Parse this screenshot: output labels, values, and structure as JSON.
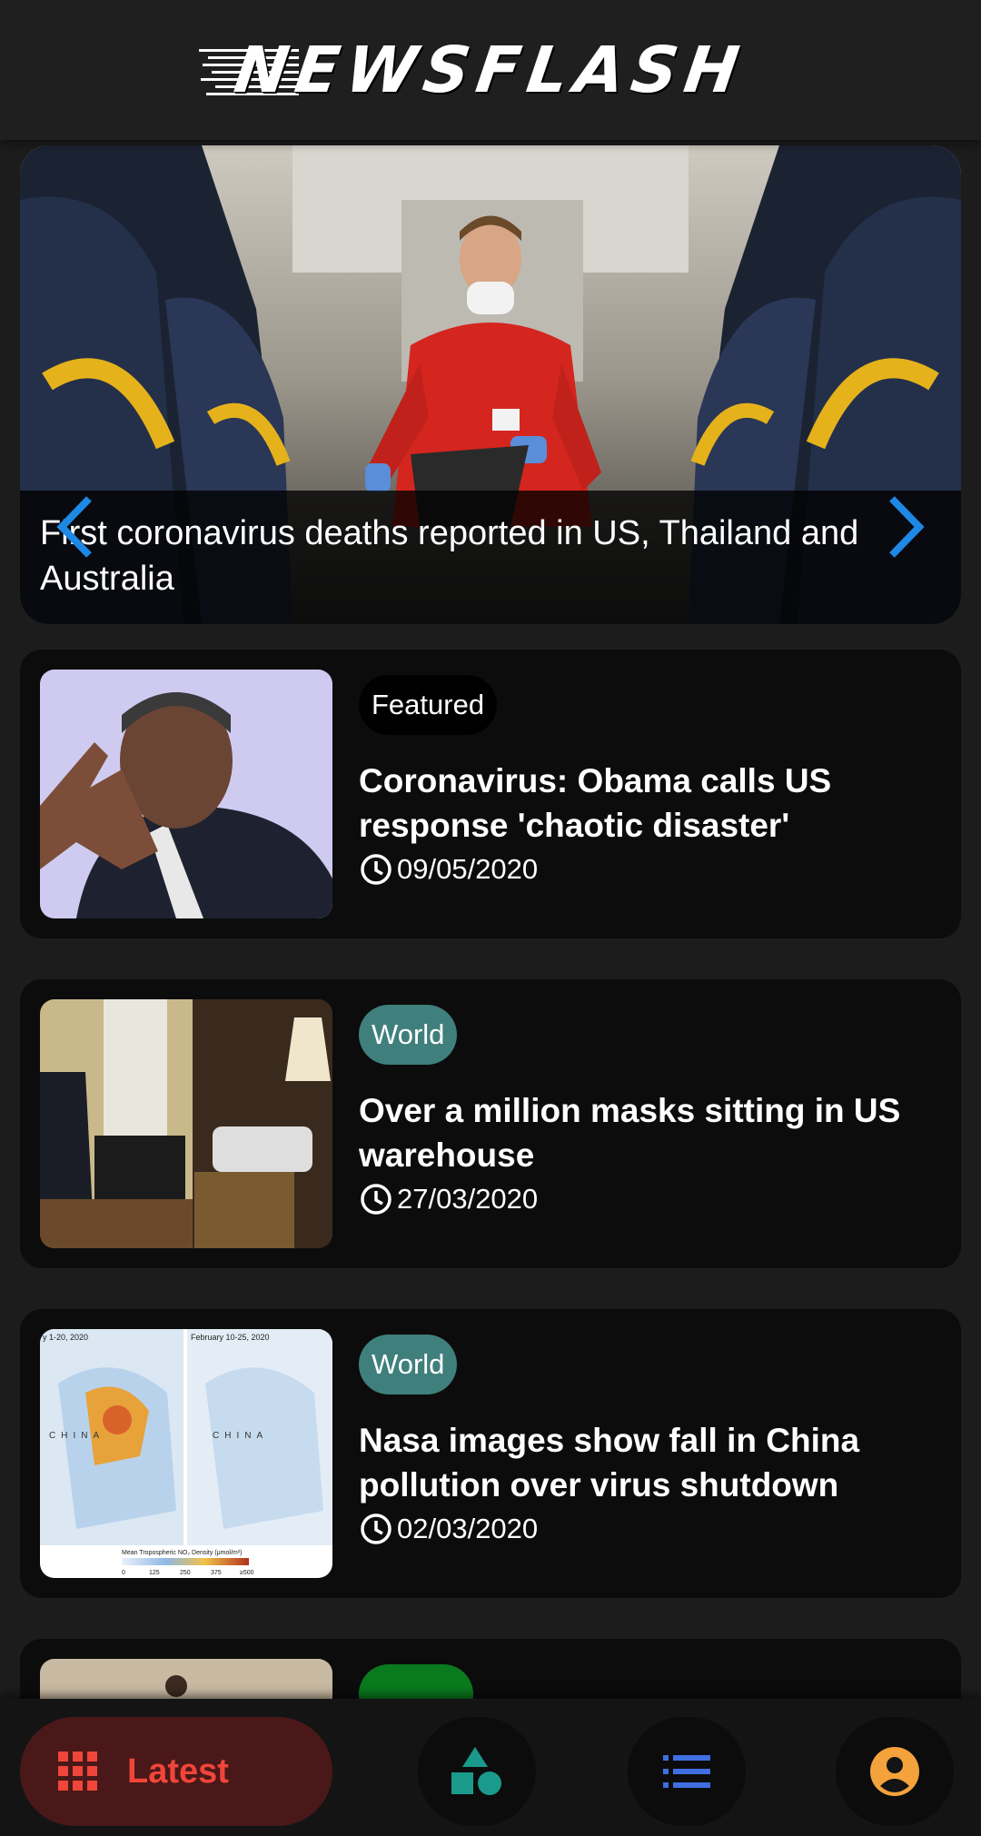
{
  "app": {
    "name": "NEWSFLASH"
  },
  "hero": {
    "headline": "First coronavirus deaths reported in US, Thailand and Australia",
    "prev_icon": "chevron-left-icon",
    "next_icon": "chevron-right-icon",
    "arrow_color": "#1e88e5"
  },
  "articles": [
    {
      "category": "Featured",
      "category_color": "#000000",
      "title": "Coronavirus: Obama calls US response 'chaotic disaster'",
      "date": "09/05/2020"
    },
    {
      "category": "World",
      "category_color": "#3f7f7c",
      "title": "Over a million masks sitting in US warehouse",
      "date": "27/03/2020"
    },
    {
      "category": "World",
      "category_color": "#3f7f7c",
      "title": "Nasa images show fall in China pollution over virus shutdown",
      "date": "02/03/2020"
    }
  ],
  "map_labels": {
    "left_date": "y 1-20, 2020",
    "right_date": "February 10-25, 2020",
    "country": "CHINA",
    "legend_title": "Mean Tropospheric NO₂ Density (μmol/m²)",
    "legend_ticks": [
      "0",
      "125",
      "250",
      "375",
      "≥500"
    ]
  },
  "partial_card": {
    "category_color": "#0a7a1e"
  },
  "bottom_nav": {
    "active_label": "Latest",
    "active_icon": "grid-icon",
    "accent": "#f0453a",
    "items": [
      {
        "name": "categories",
        "icon": "shapes-icon",
        "color": "#1a9a8a"
      },
      {
        "name": "list",
        "icon": "list-icon",
        "color": "#3f6fe0"
      },
      {
        "name": "profile",
        "icon": "account-icon",
        "color": "#f4a23c"
      }
    ]
  }
}
